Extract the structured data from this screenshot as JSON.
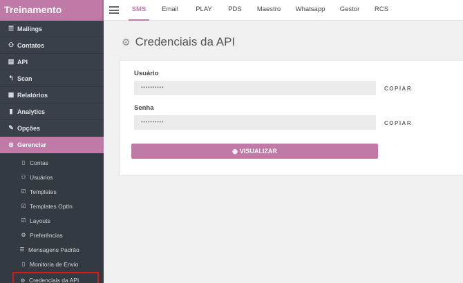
{
  "brand": "Treinamento",
  "topnav": {
    "tabs": [
      "SMS",
      "Email",
      "PLAY",
      "PDS",
      "Maestro",
      "Whatsapp",
      "Gestor",
      "RCS"
    ],
    "active": "SMS"
  },
  "sidebar": {
    "items": [
      {
        "label": "Mailings",
        "icon": "list-icon"
      },
      {
        "label": "Contatos",
        "icon": "users-icon"
      },
      {
        "label": "API",
        "icon": "code-icon"
      },
      {
        "label": "Scan",
        "icon": "reply-icon"
      },
      {
        "label": "Relatórios",
        "icon": "table-icon"
      },
      {
        "label": "Analytics",
        "icon": "bar-chart-icon"
      },
      {
        "label": "Opções",
        "icon": "wrench-icon"
      },
      {
        "label": "Gerenciar",
        "icon": "gear-icon"
      }
    ],
    "subitems": [
      {
        "label": "Contas",
        "icon": "document-icon"
      },
      {
        "label": "Usuários",
        "icon": "users-icon"
      },
      {
        "label": "Templates",
        "icon": "edit-icon"
      },
      {
        "label": "Templates OptIn",
        "icon": "edit-icon"
      },
      {
        "label": "Layouts",
        "icon": "edit-icon"
      },
      {
        "label": "Preferências",
        "icon": "gear-icon"
      },
      {
        "label": "Mensagens Padrão",
        "icon": "list-icon"
      },
      {
        "label": "Monitoria de Envio",
        "icon": "document-icon"
      },
      {
        "label": "Credenciais da API",
        "icon": "gear-icon"
      }
    ]
  },
  "page": {
    "title": "Credenciais da API",
    "usuario_label": "Usuário",
    "usuario_value": "••••••••••",
    "senha_label": "Senha",
    "senha_value": "••••••••••",
    "copy_label": "COPIAR",
    "view_button": "VISUALIZAR"
  },
  "colors": {
    "accent": "#bf7aa7",
    "sidebar_bg": "#3a4049",
    "highlight": "#d11a1a"
  }
}
